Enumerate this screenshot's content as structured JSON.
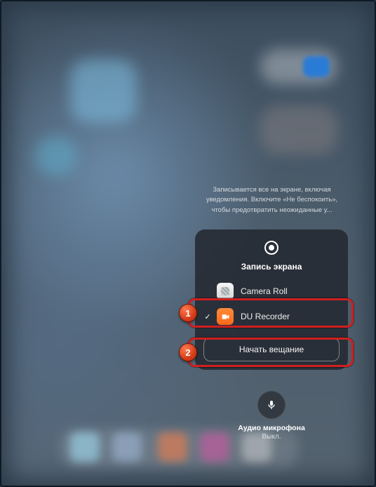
{
  "info_text": "Записывается все на экране, включая уведомления. Включите «Не беспокоить», чтобы предотвратить неожиданные у...",
  "panel": {
    "title": "Запись экрана",
    "items": [
      {
        "label": "Camera Roll",
        "selected": false
      },
      {
        "label": "DU Recorder",
        "selected": true
      }
    ],
    "action_label": "Начать вещание"
  },
  "microphone": {
    "label": "Аудио микрофона",
    "state": "Выкл."
  },
  "markers": {
    "m1": "1",
    "m2": "2"
  }
}
